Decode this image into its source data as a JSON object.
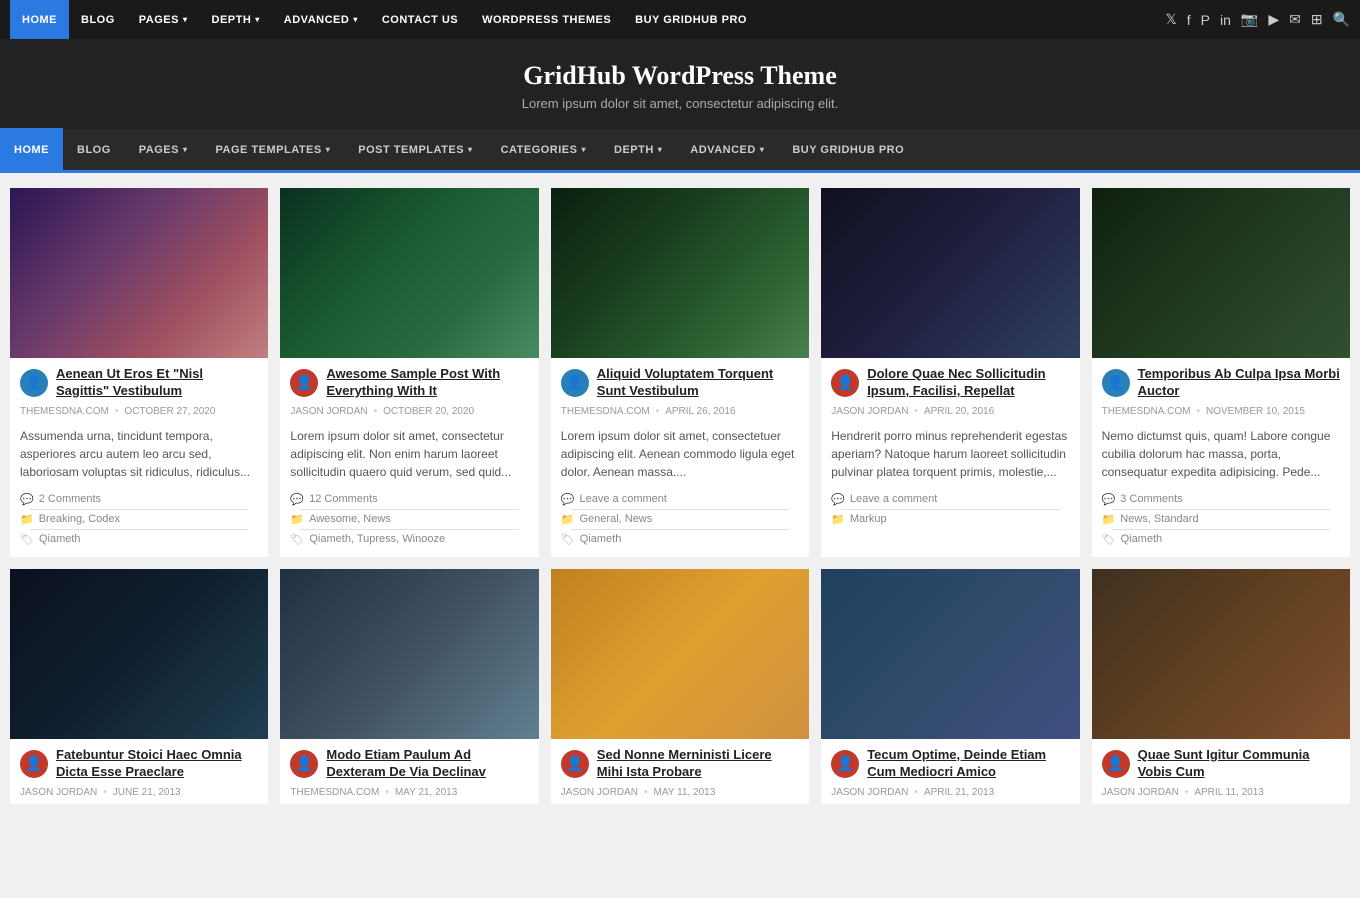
{
  "topNav": {
    "links": [
      {
        "label": "HOME",
        "active": true,
        "hasArrow": false
      },
      {
        "label": "BLOG",
        "active": false,
        "hasArrow": false
      },
      {
        "label": "PAGES",
        "active": false,
        "hasArrow": true
      },
      {
        "label": "DEPTH",
        "active": false,
        "hasArrow": true
      },
      {
        "label": "ADVANCED",
        "active": false,
        "hasArrow": true
      },
      {
        "label": "CONTACT US",
        "active": false,
        "hasArrow": false
      },
      {
        "label": "WORDPRESS THEMES",
        "active": false,
        "hasArrow": false
      },
      {
        "label": "BUY GRIDHUB PRO",
        "active": false,
        "hasArrow": false
      }
    ],
    "icons": [
      "𝕏",
      "f",
      "𝐏",
      "in",
      "📷",
      "▶",
      "✉",
      "⊞",
      "🔍"
    ]
  },
  "header": {
    "title": "GridHub WordPress Theme",
    "tagline": "Lorem ipsum dolor sit amet, consectetur adipiscing elit."
  },
  "mainNav": {
    "links": [
      {
        "label": "HOME",
        "active": true,
        "hasArrow": false
      },
      {
        "label": "BLOG",
        "active": false,
        "hasArrow": false
      },
      {
        "label": "PAGES",
        "active": false,
        "hasArrow": true
      },
      {
        "label": "PAGE TEMPLATES",
        "active": false,
        "hasArrow": true
      },
      {
        "label": "POST TEMPLATES",
        "active": false,
        "hasArrow": true
      },
      {
        "label": "CATEGORIES",
        "active": false,
        "hasArrow": true
      },
      {
        "label": "DEPTH",
        "active": false,
        "hasArrow": true
      },
      {
        "label": "ADVANCED",
        "active": false,
        "hasArrow": true
      },
      {
        "label": "BUY GRIDHUB PRO",
        "active": false,
        "hasArrow": false
      }
    ]
  },
  "posts": [
    {
      "id": 1,
      "imgClass": "img-1",
      "avatarClass": "avatar-blue",
      "avatarIcon": "👤",
      "title": "Aenean Ut Eros Et \"Nisl Sagittis\" Vestibulum",
      "author": "THEMESDNA.COM",
      "date": "OCTOBER 27, 2020",
      "excerpt": "Assumenda urna, tincidunt tempora, asperiores arcu autem leo arcu sed, laboriosam voluptas sit ridiculus, ridiculus...",
      "comments": "2 Comments",
      "categories": "Breaking, Codex",
      "tags": "Qiameth"
    },
    {
      "id": 2,
      "imgClass": "img-2",
      "avatarClass": "avatar-red",
      "avatarIcon": "👤",
      "title": "Awesome Sample Post With Everything With It",
      "author": "JASON JORDAN",
      "date": "OCTOBER 20, 2020",
      "excerpt": "Lorem ipsum dolor sit amet, consectetur adipiscing elit. Non enim harum laoreet sollicitudin quaero quid verum, sed quid...",
      "comments": "12 Comments",
      "categories": "Awesome, News",
      "tags": "Qiameth, Tupress, Winooze"
    },
    {
      "id": 3,
      "imgClass": "img-3",
      "avatarClass": "avatar-blue",
      "avatarIcon": "👤",
      "title": "Aliquid Voluptatem Torquent Sunt Vestibulum",
      "author": "THEMESDNA.COM",
      "date": "APRIL 26, 2016",
      "excerpt": "Lorem ipsum dolor sit amet, consectetuer adipiscing elit. Aenean commodo ligula eget dolor. Aenean massa....",
      "comments": "Leave a comment",
      "categories": "General, News",
      "tags": "Qiameth"
    },
    {
      "id": 4,
      "imgClass": "img-4",
      "avatarClass": "avatar-red",
      "avatarIcon": "👤",
      "title": "Dolore Quae Nec Sollicitudin Ipsum, Facilisi, Repellat",
      "author": "JASON JORDAN",
      "date": "APRIL 20, 2016",
      "excerpt": "Hendrerit porro minus reprehenderit egestas aperiam? Natoque harum laoreet sollicitudin pulvinar platea torquent primis, molestie,...",
      "comments": "Leave a comment",
      "categories": "Markup",
      "tags": ""
    },
    {
      "id": 5,
      "imgClass": "img-5",
      "avatarClass": "avatar-blue",
      "avatarIcon": "👤",
      "title": "Temporibus Ab Culpa Ipsa Morbi Auctor",
      "author": "THEMESDNA.COM",
      "date": "NOVEMBER 10, 2015",
      "excerpt": "Nemo dictumst quis, quam! Labore congue cubilia dolorum hac massa, porta, consequatur expedita adipisicing. Pede...",
      "comments": "3 Comments",
      "categories": "News, Standard",
      "tags": "Qiameth"
    },
    {
      "id": 6,
      "imgClass": "img-6",
      "avatarClass": "avatar-red",
      "avatarIcon": "👤",
      "title": "Fatebuntur Stoici Haec Omnia Dicta Esse Praeclare",
      "author": "JASON JORDAN",
      "date": "JUNE 21, 2013",
      "excerpt": "",
      "comments": "",
      "categories": "",
      "tags": ""
    },
    {
      "id": 7,
      "imgClass": "img-7",
      "avatarClass": "avatar-red",
      "avatarIcon": "👤",
      "title": "Modo Etiam Paulum Ad Dexteram De Via Declinav",
      "author": "THEMESDNA.COM",
      "date": "MAY 21, 2013",
      "excerpt": "",
      "comments": "",
      "categories": "",
      "tags": ""
    },
    {
      "id": 8,
      "imgClass": "img-8",
      "avatarClass": "avatar-red",
      "avatarIcon": "👤",
      "title": "Sed Nonne Merninisti Licere Mihi Ista Probare",
      "author": "JASON JORDAN",
      "date": "MAY 11, 2013",
      "excerpt": "",
      "comments": "",
      "categories": "",
      "tags": ""
    },
    {
      "id": 9,
      "imgClass": "img-9",
      "avatarClass": "avatar-red",
      "avatarIcon": "👤",
      "title": "Tecum Optime, Deinde Etiam Cum Mediocri Amico",
      "author": "JASON JORDAN",
      "date": "APRIL 21, 2013",
      "excerpt": "",
      "comments": "",
      "categories": "",
      "tags": ""
    },
    {
      "id": 10,
      "imgClass": "img-10",
      "avatarClass": "avatar-red",
      "avatarIcon": "👤",
      "title": "Quae Sunt Igitur Communia Vobis Cum",
      "author": "JASON JORDAN",
      "date": "APRIL 11, 2013",
      "excerpt": "",
      "comments": "",
      "categories": "",
      "tags": ""
    }
  ]
}
